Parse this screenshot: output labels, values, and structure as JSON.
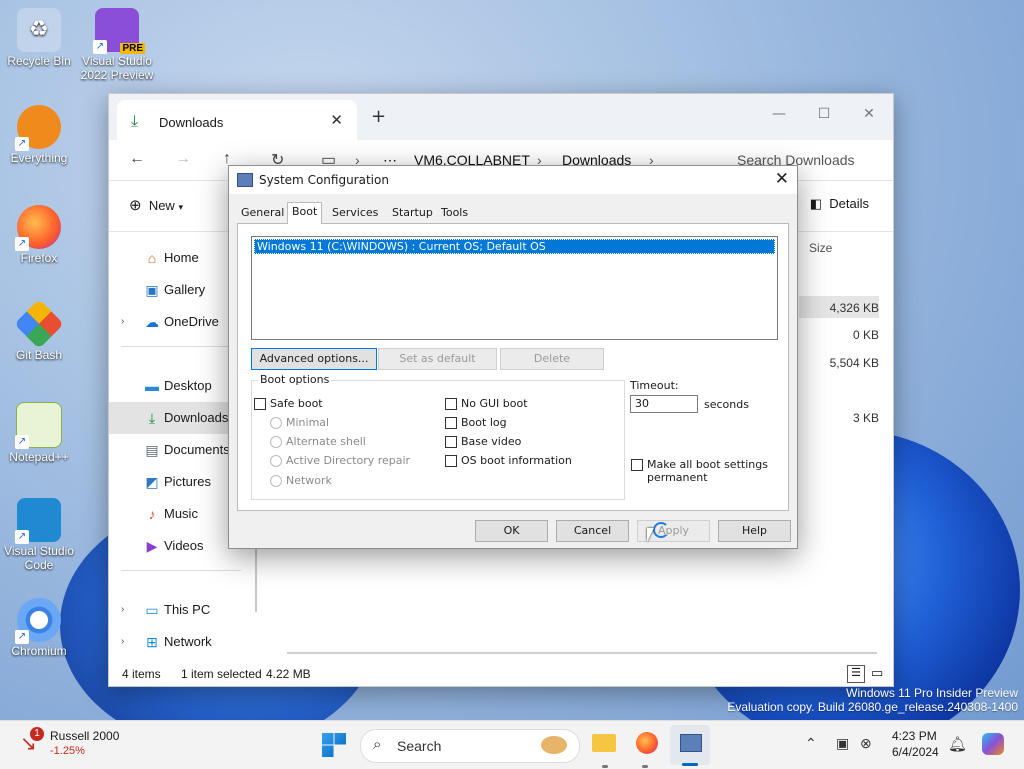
{
  "desktop": {
    "icons": [
      {
        "label": "Recycle Bin",
        "icon": "recycle-bin-icon"
      },
      {
        "label": "Visual Studio 2022 Preview",
        "badge": "PRE",
        "icon": "visual-studio-icon"
      },
      {
        "label": "Everything",
        "icon": "everything-search-icon"
      },
      {
        "label": "Firefox",
        "icon": "firefox-icon"
      },
      {
        "label": "Git Bash",
        "icon": "git-bash-icon"
      },
      {
        "label": "Notepad++",
        "icon": "notepad-plus-icon"
      },
      {
        "label": "Visual Studio Code",
        "icon": "vscode-icon"
      },
      {
        "label": "Chromium",
        "icon": "chromium-icon"
      }
    ]
  },
  "explorer": {
    "tab_title": "Downloads",
    "breadcrumb": [
      "VM6.COLLABNET",
      "Downloads"
    ],
    "search_placeholder": "Search Downloads",
    "new_label": "New",
    "details_label": "Details",
    "size_header": "Size",
    "sizes": [
      "4,326 KB",
      "0 KB",
      "5,504 KB",
      "3 KB"
    ],
    "nav": [
      {
        "label": "Home",
        "icon": "home-icon"
      },
      {
        "label": "Gallery",
        "icon": "gallery-icon"
      },
      {
        "label": "OneDrive",
        "icon": "onedrive-icon"
      },
      {
        "label": "Desktop",
        "icon": "desktop-icon"
      },
      {
        "label": "Downloads",
        "icon": "downloads-icon"
      },
      {
        "label": "Documents",
        "icon": "documents-icon"
      },
      {
        "label": "Pictures",
        "icon": "pictures-icon"
      },
      {
        "label": "Music",
        "icon": "music-icon"
      },
      {
        "label": "Videos",
        "icon": "videos-icon"
      },
      {
        "label": "This PC",
        "icon": "this-pc-icon"
      },
      {
        "label": "Network",
        "icon": "network-icon"
      }
    ],
    "status_items": "4 items",
    "status_selected": "1 item selected",
    "status_size": "4.22 MB"
  },
  "dialog": {
    "title": "System Configuration",
    "tabs": [
      "General",
      "Boot",
      "Services",
      "Startup",
      "Tools"
    ],
    "active_tab": "Boot",
    "os_entry": "Windows 11 (C:\\WINDOWS) : Current OS; Default OS",
    "buttons": {
      "advanced": "Advanced options...",
      "set_default": "Set as default",
      "delete": "Delete",
      "ok": "OK",
      "cancel": "Cancel",
      "apply": "Apply",
      "help": "Help"
    },
    "boot_options_label": "Boot options",
    "safe_boot": "Safe boot",
    "safe_modes": [
      "Minimal",
      "Alternate shell",
      "Active Directory repair",
      "Network"
    ],
    "right_options": [
      "No GUI boot",
      "Boot log",
      "Base video",
      "OS boot information"
    ],
    "timeout_label": "Timeout:",
    "timeout_value": "30",
    "seconds_label": "seconds",
    "make_permanent": "Make all boot settings permanent"
  },
  "taskbar": {
    "stock_name": "Russell 2000",
    "stock_change": "-1.25%",
    "stock_badge": "1",
    "search_label": "Search",
    "time": "4:23 PM",
    "date": "6/4/2024"
  },
  "watermark": {
    "line1": "Windows 11 Pro Insider Preview",
    "line2": "Evaluation copy. Build 26080.ge_release.240308-1400"
  },
  "colors": {
    "accent": "#0078d7",
    "selection": "#0078d7",
    "stock_down": "#c42b1c"
  }
}
